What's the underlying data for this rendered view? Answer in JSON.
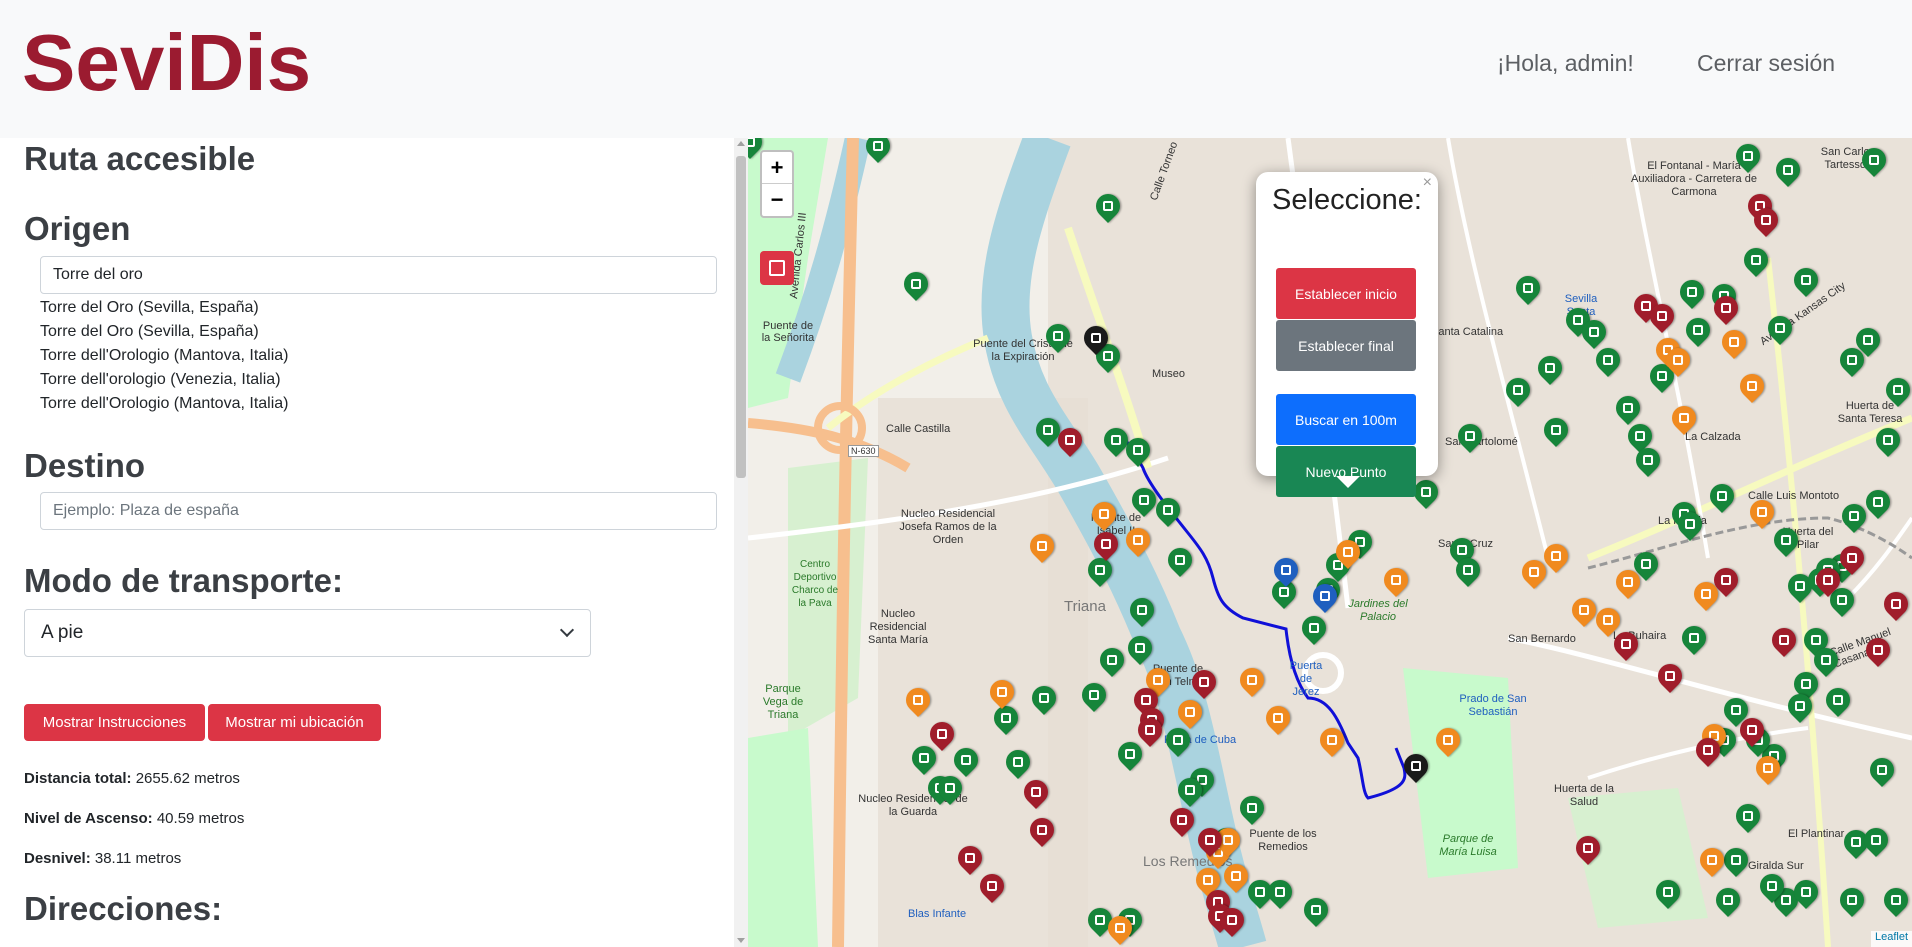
{
  "navbar": {
    "brand": "SeviDis",
    "greeting": "¡Hola, admin!",
    "logout": "Cerrar sesión"
  },
  "panel": {
    "title": "Ruta accesible",
    "origin_heading": "Origen",
    "origin_value": "Torre del oro",
    "suggestions": [
      "Torre del Oro (Sevilla, España)",
      "Torre del Oro (Sevilla, España)",
      "Torre dell'Orologio (Mantova, Italia)",
      "Torre dell'orologio (Venezia, Italia)",
      "Torre dell'Orologio (Mantova, Italia)"
    ],
    "destination_heading": "Destino",
    "destination_placeholder": "Ejemplo: Plaza de españa",
    "transport_heading": "Modo de transporte:",
    "transport_value": "A pie",
    "btn_instructions": "Mostrar Instrucciones",
    "btn_location": "Mostrar mi ubicación",
    "distance_label": "Distancia total:",
    "distance_value": "2655.62 metros",
    "ascent_label": "Nivel de Ascenso:",
    "ascent_value": "40.59 metros",
    "slope_label": "Desnivel:",
    "slope_value": "38.11 metros",
    "directions_heading": "Direcciones:"
  },
  "map": {
    "zoom_in": "+",
    "zoom_out": "−",
    "attribution": "Leaflet",
    "popup": {
      "title": "Seleccione:",
      "close": "×",
      "btn_start": "Establecer inicio",
      "btn_end": "Establecer final",
      "btn_search": "Buscar en 100m",
      "btn_new": "Nuevo Punto"
    },
    "labels": [
      "Puente de la Señorita",
      "Avenida Carlos III",
      "Puente del Cristo de la Expiración",
      "Calle Castilla",
      "N-630",
      "Nucleo Residencial Josefa Ramos de la Orden",
      "Puente de Isabel II",
      "Triana",
      "Nucleo Residencial Santa María",
      "Parque Vega de Triana",
      "Centro Deportivo Charco de la Pava",
      "Nucleo Residencial de la Guarda",
      "Puente de San Telmo",
      "Puerta de Jerez",
      "Jardines del Palacio",
      "Santa Cruz",
      "Prado de San Sebastián",
      "Parque de María Luisa",
      "Los Remedios",
      "Puente de los Remedios",
      "San Bernardo",
      "La Buhaira",
      "La Florida",
      "Huerta del Pilar",
      "San Bartolomé",
      "Santa Catalina",
      "La Calzada",
      "Huerta de Santa Teresa",
      "Calle Luis Montoto",
      "Sevilla Santa Justa",
      "El Fontanal - María Auxiliadora - Carretera de Carmona",
      "San Carlos Tartessos",
      "Huerta de la Salud",
      "El Plantinar",
      "Giralda Sur",
      "Museo",
      "Blas Infante",
      "Calle Torneo",
      "Plaza de Cuba",
      "Avenida Kansas City",
      "Calle Manuel Casana"
    ],
    "colors": {
      "green": "#16853a",
      "orange": "#f08a1f",
      "red": "#a01d2b",
      "blue": "#1f5fbf",
      "black": "#1a1a1a",
      "route": "#1010d8",
      "river": "#aad3df",
      "park": "#c8facc"
    }
  }
}
